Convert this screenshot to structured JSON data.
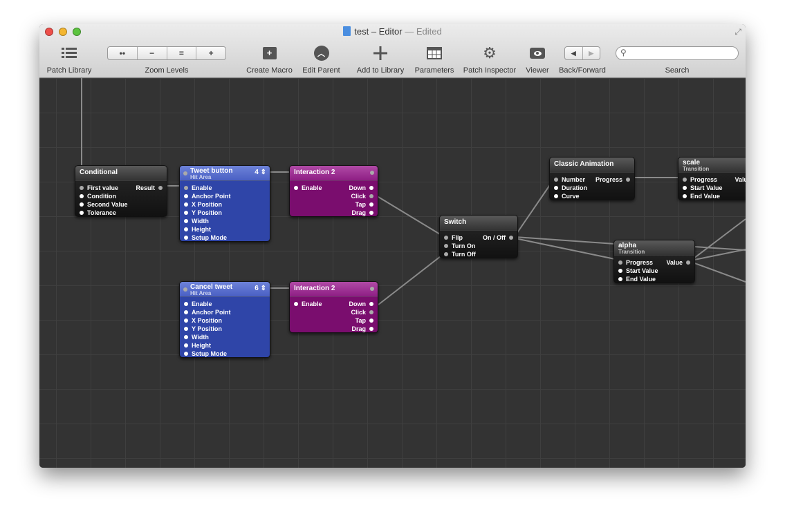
{
  "window": {
    "title": "test – Editor",
    "edited": "— Edited"
  },
  "toolbar": {
    "patch_library": "Patch Library",
    "zoom_levels": "Zoom Levels",
    "zoom_buttons": [
      "••",
      "−",
      "=",
      "+"
    ],
    "create_macro": "Create Macro",
    "edit_parent": "Edit Parent",
    "add_to_library": "Add to Library",
    "parameters": "Parameters",
    "patch_inspector": "Patch Inspector",
    "viewer": "Viewer",
    "back_forward": "Back/Forward",
    "search": "Search",
    "search_placeholder": ""
  },
  "nodes": {
    "conditional": {
      "title": "Conditional",
      "inputs": [
        "First value",
        "Condition",
        "Second Value",
        "Tolerance"
      ],
      "outputs": [
        "Result"
      ]
    },
    "tweet": {
      "title": "Tweet button",
      "subtitle": "Hit Area",
      "count": "4 ⇕",
      "inputs": [
        "Enable",
        "Anchor Point",
        "X Position",
        "Y Position",
        "Width",
        "Height",
        "Setup Mode"
      ]
    },
    "interaction1": {
      "title": "Interaction 2",
      "inputs": [
        "Enable"
      ],
      "outputs": [
        "Down",
        "Click",
        "Tap",
        "Drag"
      ]
    },
    "cancel": {
      "title": "Cancel tweet",
      "subtitle": "Hit Area",
      "count": "6 ⇕",
      "inputs": [
        "Enable",
        "Anchor Point",
        "X Position",
        "Y Position",
        "Width",
        "Height",
        "Setup Mode"
      ]
    },
    "interaction2": {
      "title": "Interaction 2",
      "inputs": [
        "Enable"
      ],
      "outputs": [
        "Down",
        "Click",
        "Tap",
        "Drag"
      ]
    },
    "switch": {
      "title": "Switch",
      "inputs": [
        "Flip",
        "Turn On",
        "Turn Off"
      ],
      "outputs": [
        "On / Off"
      ]
    },
    "classic": {
      "title": "Classic Animation",
      "inputs": [
        "Number",
        "Duration",
        "Curve"
      ],
      "outputs": [
        "Progress"
      ]
    },
    "scale": {
      "title": "scale",
      "subtitle": "Transition",
      "inputs": [
        "Progress",
        "Start Value",
        "End Value"
      ],
      "outputs": [
        "Value"
      ]
    },
    "alpha": {
      "title": "alpha",
      "subtitle": "Transition",
      "inputs": [
        "Progress",
        "Start Value",
        "End Value"
      ],
      "outputs": [
        "Value"
      ]
    }
  },
  "colors": {
    "canvas": "#333333",
    "macro_blue": "#2f45a8",
    "interaction_purple": "#7a0d6e",
    "patch_dark": "#1e1e1e"
  }
}
